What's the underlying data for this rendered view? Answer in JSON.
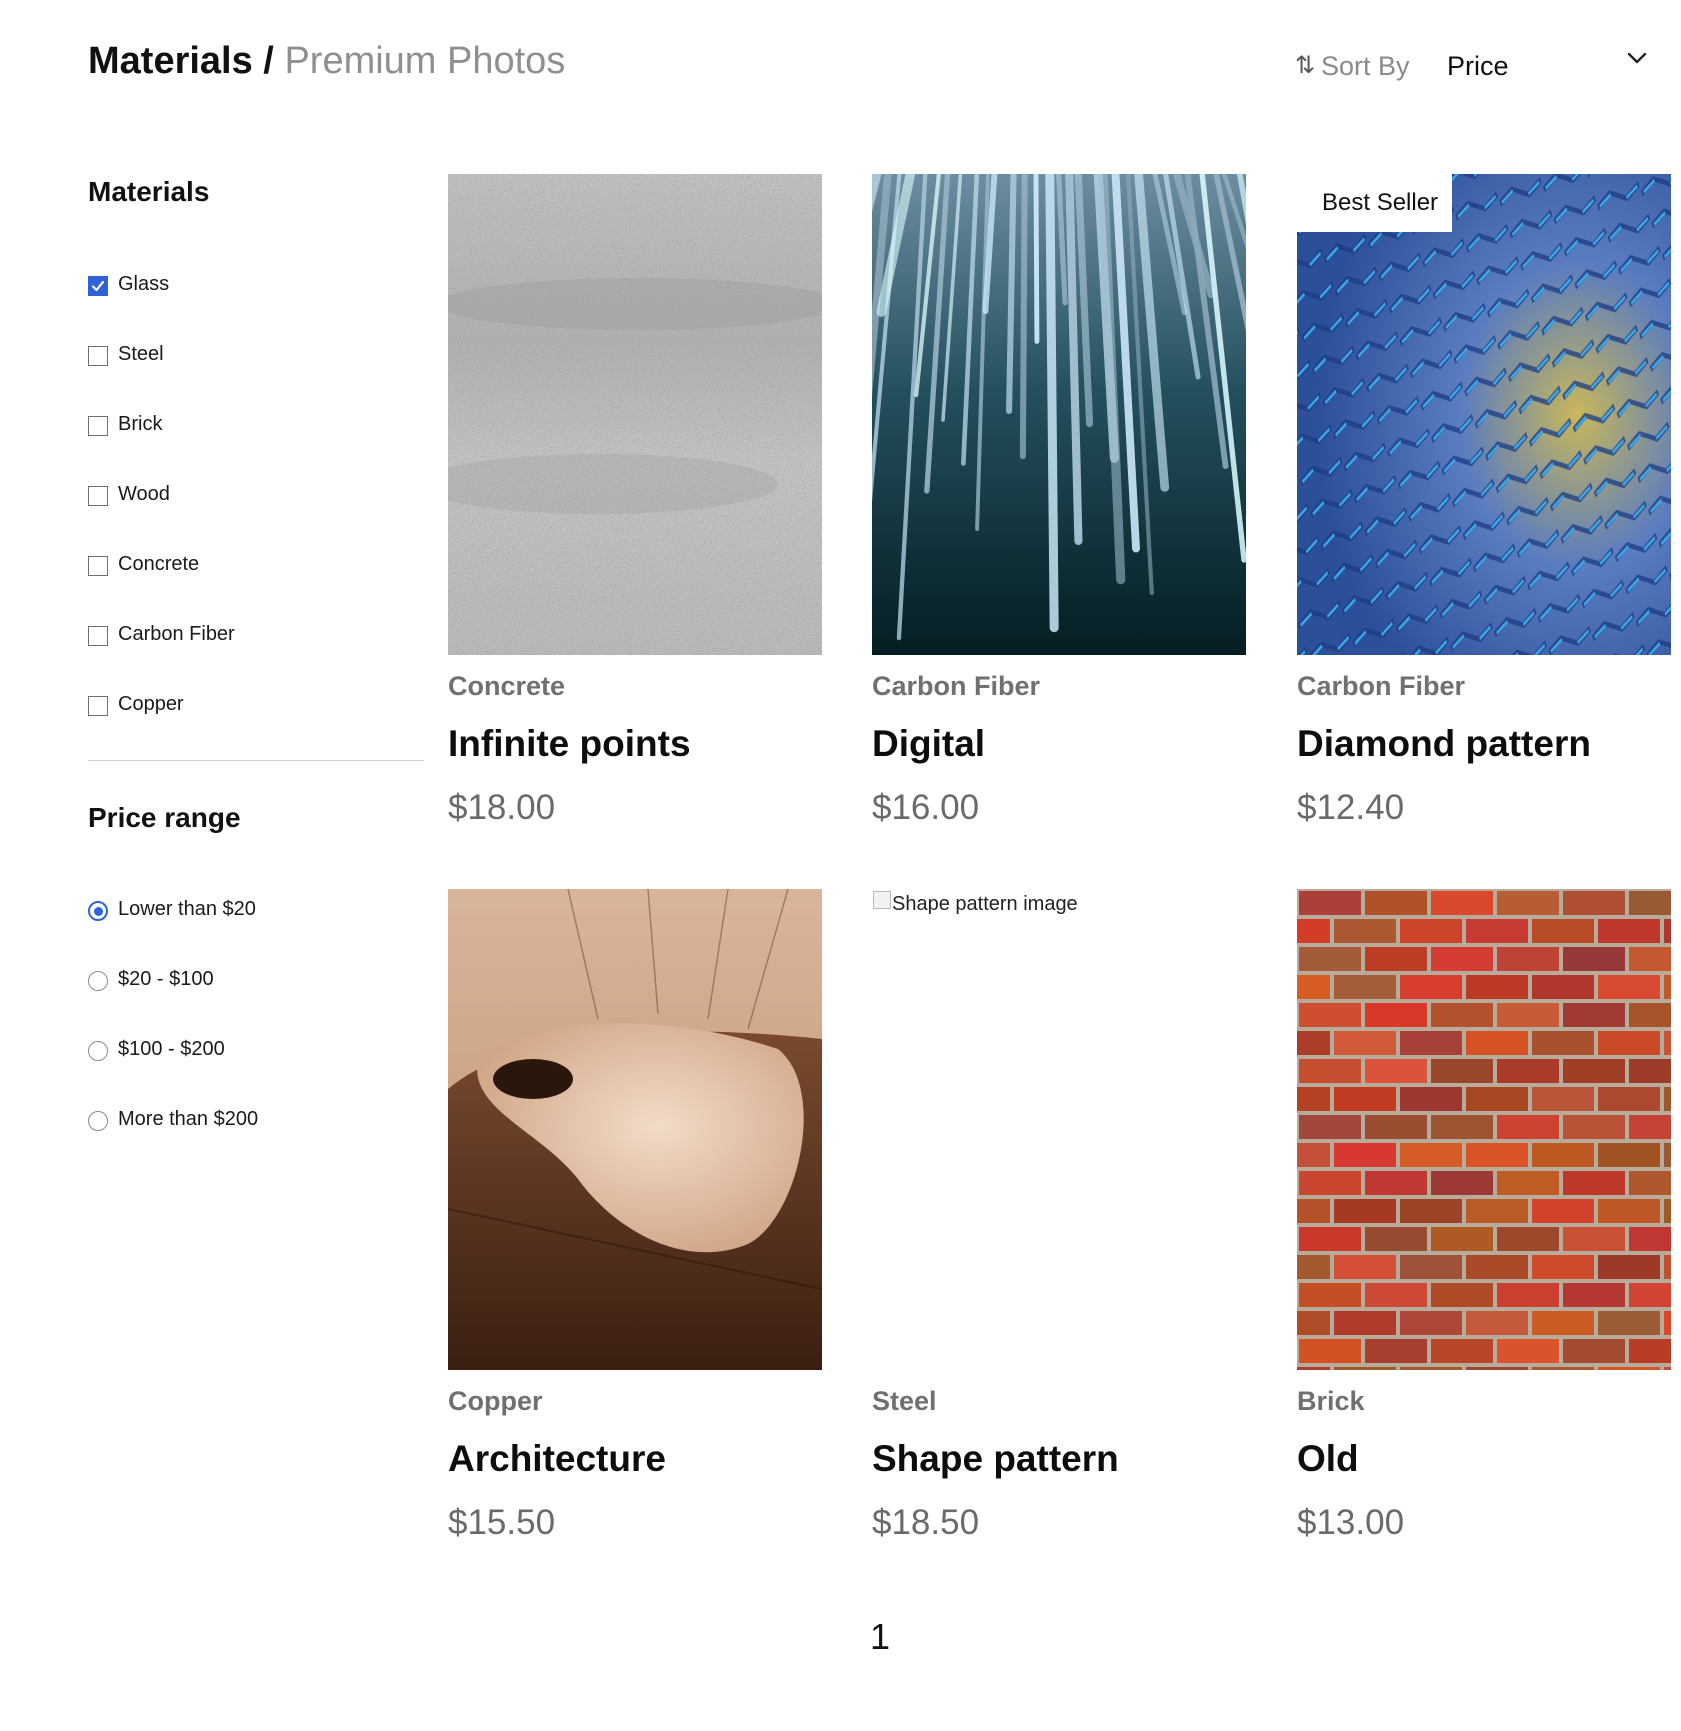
{
  "header": {
    "title_main": "Materials /",
    "title_sub": "Premium Photos",
    "sort_label": "Sort By",
    "sort_value": "Price",
    "sort_icon": "sort-arrows-icon"
  },
  "sidebar": {
    "materials_heading": "Materials",
    "materials": [
      {
        "label": "Glass",
        "checked": true
      },
      {
        "label": "Steel",
        "checked": false
      },
      {
        "label": "Brick",
        "checked": false
      },
      {
        "label": "Wood",
        "checked": false
      },
      {
        "label": "Concrete",
        "checked": false
      },
      {
        "label": "Carbon Fiber",
        "checked": false
      },
      {
        "label": "Copper",
        "checked": false
      }
    ],
    "price_heading": "Price range",
    "price_ranges": [
      {
        "label": "Lower than $20",
        "selected": true
      },
      {
        "label": "$20 - $100",
        "selected": false
      },
      {
        "label": "$100 - $200",
        "selected": false
      },
      {
        "label": "More than $200",
        "selected": false
      }
    ]
  },
  "products": [
    {
      "category": "Concrete",
      "name": "Infinite points",
      "price": "$18.00",
      "badge": null,
      "image": "concrete-texture"
    },
    {
      "category": "Carbon Fiber",
      "name": "Digital",
      "price": "$16.00",
      "badge": null,
      "image": "light-rods"
    },
    {
      "category": "Carbon Fiber",
      "name": "Diamond pattern",
      "price": "$12.40",
      "badge": "Best Seller",
      "image": "blue-diamond-pattern"
    },
    {
      "category": "Copper",
      "name": "Architecture",
      "price": "$15.50",
      "badge": null,
      "image": "copper-architecture"
    },
    {
      "category": "Steel",
      "name": "Shape pattern",
      "price": "$18.50",
      "badge": null,
      "image": "broken-image",
      "image_alt": "Shape pattern image"
    },
    {
      "category": "Brick",
      "name": "Old",
      "price": "$13.00",
      "badge": null,
      "image": "brick-wall"
    }
  ],
  "pagination": {
    "current": "1"
  },
  "colors": {
    "accent": "#2f62d8",
    "muted_text": "#707070",
    "divider": "#d2d2d2"
  }
}
